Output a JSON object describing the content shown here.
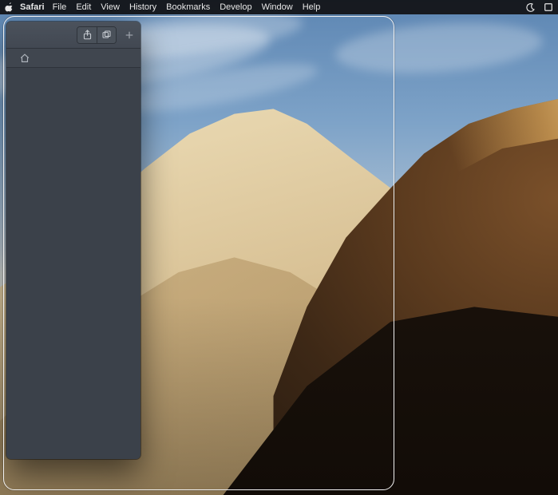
{
  "menubar": {
    "app_name": "Safari",
    "items": [
      "File",
      "Edit",
      "View",
      "History",
      "Bookmarks",
      "Develop",
      "Window",
      "Help"
    ]
  },
  "icons": {
    "apple": "apple-logo",
    "do_not_disturb": "crescent-moon",
    "fullscreen": "fullscreen-square",
    "share": "share-up-arrow-box",
    "tabs": "tab-overview-squares",
    "new_tab": "plus",
    "home_tab": "house-outline"
  }
}
